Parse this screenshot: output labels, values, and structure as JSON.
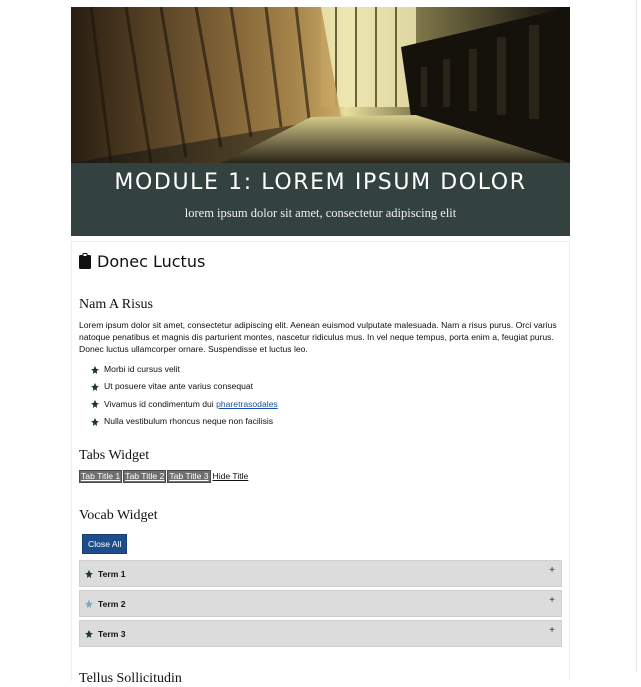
{
  "hero": {
    "title": "MODULE 1: LOREM IPSUM DOLOR",
    "subtitle": "lorem ipsum dolor sit amet, consectetur adipiscing elit"
  },
  "section": {
    "icon": "clipboard-icon",
    "title": "Donec Luctus"
  },
  "nam_a_risus": {
    "heading": "Nam A Risus",
    "paragraph": "Lorem ipsum dolor sit amet, consectetur adipiscing elit. Aenean euismod vulputate malesuada. Nam a risus purus. Orci varius natoque penatibus et magnis dis parturient montes, nascetur ridiculus mus. In vel neque tempus, porta enim a, feugiat purus. Donec luctus ullamcorper ornare. Suspendisse et luctus leo.",
    "bullet_icon": "leaf-icon",
    "bullets": [
      "Morbi id cursus velit",
      "Ut posuere vitae ante varius consequat",
      "Vivamus id condimentum dui ",
      "Nulla vestibulum rhoncus neque non facilisis"
    ],
    "link_text": "pharetrasodales"
  },
  "tabs_widget": {
    "heading": "Tabs Widget",
    "tabs": [
      "Tab Title 1",
      "Tab Title 2",
      "Tab Title 3"
    ],
    "hide_label": "Hide Title"
  },
  "vocab_widget": {
    "heading": "Vocab Widget",
    "close_all_label": "Close All",
    "expand_icon": "plus-icon",
    "terms": [
      "Term 1",
      "Term 2",
      "Term 3"
    ]
  },
  "tellus": {
    "heading": "Tellus Sollicitudin"
  },
  "colors": {
    "hero_band": "#33413f",
    "button": "#1d4d8b",
    "term_bg": "#dcdcdc",
    "tab_bg": "#6f6f6f",
    "link": "#1a4fa8"
  }
}
